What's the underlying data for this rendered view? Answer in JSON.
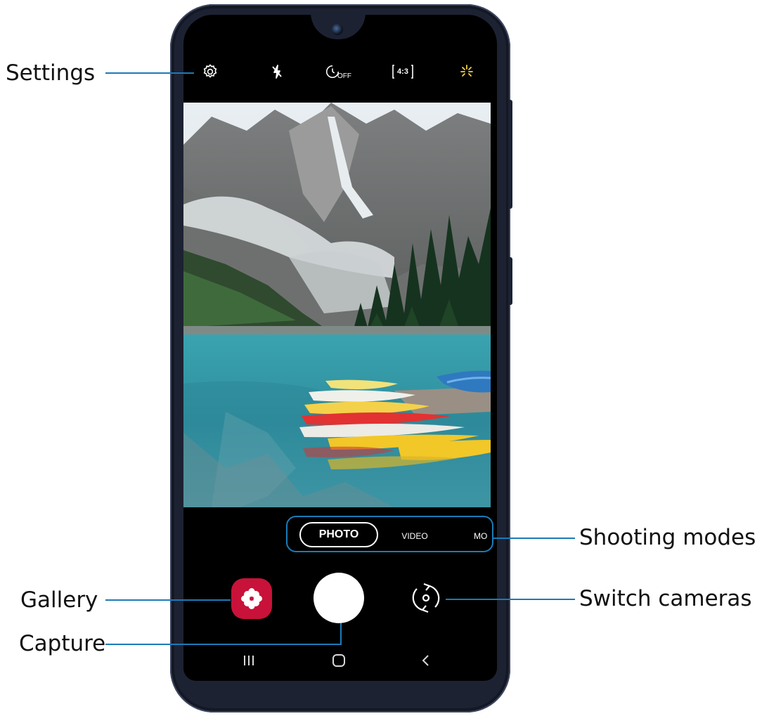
{
  "callouts": {
    "settings": "Settings",
    "shooting_modes": "Shooting modes",
    "gallery": "Gallery",
    "switch_cameras": "Switch cameras",
    "capture": "Capture"
  },
  "top_bar": {
    "icons": [
      "settings-gear-icon",
      "flash-off-icon",
      "timer-off-icon",
      "aspect-ratio-icon",
      "filters-effects-icon"
    ],
    "timer_label": "OFF",
    "ratio_label": "4:3"
  },
  "modes": {
    "selected": "PHOTO",
    "video": "VIDEO",
    "more": "MO"
  },
  "bottom": {
    "gallery_icon": "gallery-flower-icon",
    "capture_icon": "shutter-button",
    "switch_icon": "switch-camera-icon"
  },
  "navigation": [
    "recent-apps-icon",
    "home-icon",
    "back-icon"
  ],
  "colors": {
    "callout_line": "#1b7bb8",
    "gallery_bg": "#c8123a",
    "effects_icon": "#f2d23c",
    "phone_frame": "#1d2233"
  }
}
